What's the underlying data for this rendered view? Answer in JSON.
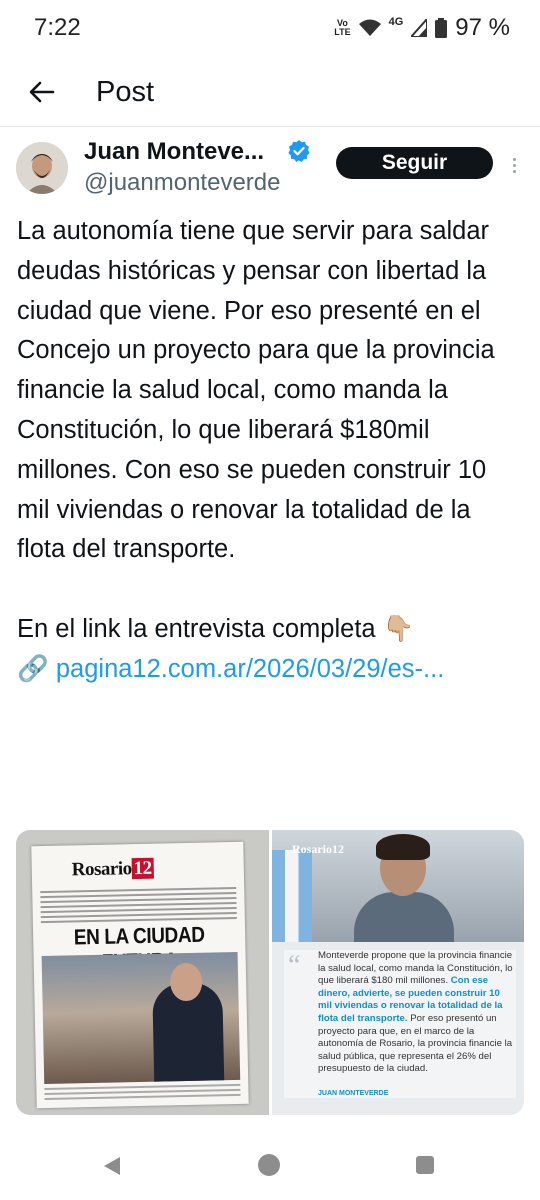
{
  "status_bar": {
    "time": "7:22",
    "volte": "Vo\nLTE",
    "network": "4G",
    "battery": "97 %"
  },
  "header": {
    "title": "Post"
  },
  "tweet": {
    "author_name": "Juan Monteve...",
    "handle": "@juanmonteverde",
    "follow_label": "Seguir",
    "paragraph_1": "La autonomía tiene que servir para saldar deudas históricas y pensar con libertad la ciudad que viene. Por eso presenté en el Concejo un proyecto para que la provincia financie la salud local, como manda la Constitución, lo que liberará $180mil millones. Con eso se pueden construir 10 mil viviendas o renovar la totalidad de la flota del transporte.",
    "paragraph_2": "En el link la entrevista completa 👇🏼",
    "link_icon": "🔗",
    "link_text": "pagina12.com.ar/2026/03/29/es-..."
  },
  "media": {
    "newspaper": {
      "masthead_a": "Rosario",
      "masthead_b": "12",
      "headline": "EN LA CIUDAD FUTURA"
    },
    "quote_card": {
      "logo": "Rosario12",
      "text_a": "Monteverde propone que la provincia financie la salud local, como manda la Constitución, lo que liberará $180 mil millones.",
      "text_highlight": "Con ese dinero, advierte, se pueden construir 10 mil viviendas o renovar la totalidad de la flota del transporte.",
      "text_b": "Por eso presentó un proyecto para que, en el marco de la autonomía de Rosario, la provincia financie la salud pública, que representa el 26% del presupuesto de la ciudad.",
      "signature": "JUAN MONTEVERDE"
    }
  },
  "colors": {
    "link": "#1d9bf0",
    "verified": "#1d9bf0",
    "follow_bg": "#0f1419"
  }
}
